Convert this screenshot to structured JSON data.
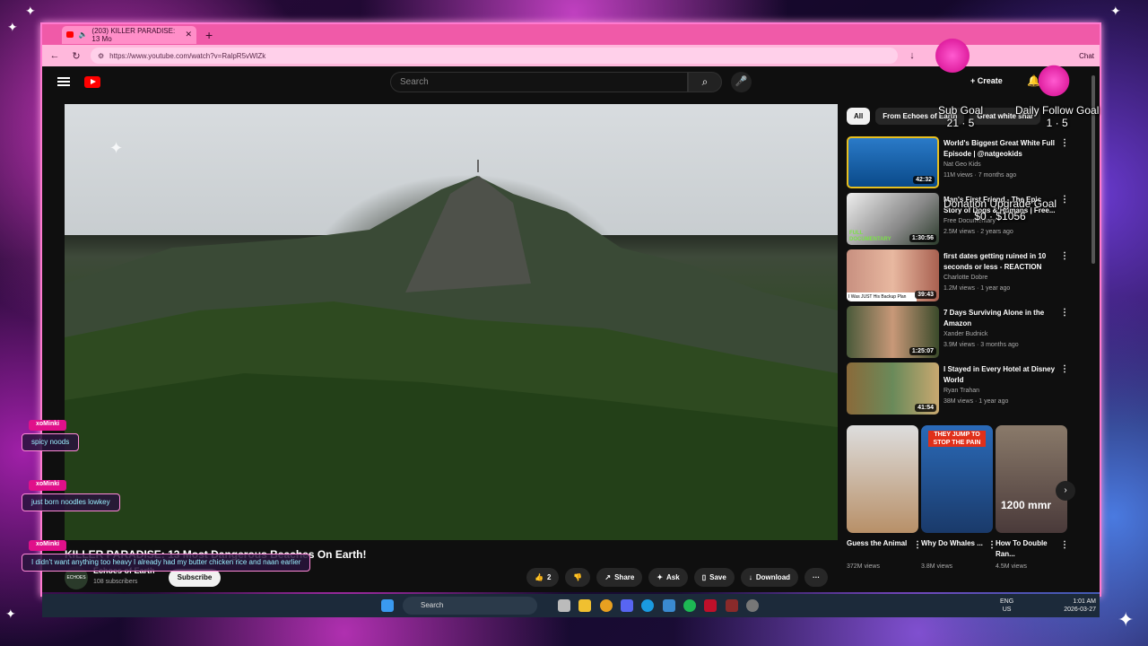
{
  "browser": {
    "tab_title": "(203) KILLER PARADISE: 13 Mo",
    "url": "https://www.youtube.com/watch?v=RalpR5vWlZk",
    "chat_label": "Chat"
  },
  "youtube": {
    "search_placeholder": "Search",
    "create_label": "Create",
    "video_title": "KILLER PARADISE: 13 Most Dangerous Beaches On Earth!",
    "channel": "Echoes of Earth",
    "subscribers": "108 subscribers",
    "subscribe_label": "Subscribe",
    "avatar_text": "ECHOES EARTH",
    "actions": {
      "likes": "2",
      "share": "Share",
      "ask": "Ask",
      "save": "Save",
      "download": "Download"
    },
    "chips": [
      "All",
      "From Echoes of Earth",
      "Great white shar"
    ],
    "recommendations": [
      {
        "title": "World's Biggest Great White Full Episode | @natgeokids",
        "channel": "Nat Geo Kids",
        "meta": "11M views · 7 months ago",
        "duration": "42:32"
      },
      {
        "title": "Man's First Friend - The Epic Story of Dogs & Humans | Free...",
        "channel": "Free Documentary",
        "meta": "2.5M views · 2 years ago",
        "duration": "1:30:56"
      },
      {
        "title": "first dates getting ruined in 10 seconds or less - REACTION",
        "channel": "Charlotte Dobre",
        "meta": "1.2M views · 1 year ago",
        "duration": "39:43"
      },
      {
        "title": "7 Days Surviving Alone in the Amazon",
        "channel": "Xander Budnick",
        "meta": "3.9M views · 3 months ago",
        "duration": "1:25:07"
      },
      {
        "title": "I Stayed in Every Hotel at Disney World",
        "channel": "Ryan Trahan",
        "meta": "38M views · 1 year ago",
        "duration": "41:54"
      }
    ],
    "thumb_text": {
      "full_documentary": "FULL DOCUMENTARY",
      "backup_plan": "I Was JUST His Backup Plan"
    },
    "shorts": [
      {
        "title": "Guess the Animal",
        "views": "372M views"
      },
      {
        "title": "Why Do Whales ...",
        "views": "3.8M views",
        "overlay": "THEY JUMP TO STOP THE PAIN"
      },
      {
        "title": "How To Double Ran...",
        "views": "4.5M views",
        "overlay": "1200 mmr"
      }
    ]
  },
  "overlay": {
    "sub_goal": {
      "label": "Sub Goal",
      "value": "21 · 5"
    },
    "follow_goal": {
      "label": "Daily Follow Goal",
      "value": "1 · 5"
    },
    "donation_goal": {
      "label": "Donation Upgrade Goal",
      "value": "$0 · $1056"
    },
    "chat": [
      {
        "user": "xoMinki",
        "message": "spicy noods"
      },
      {
        "user": "xoMinki",
        "message": "just born noodles lowkey"
      },
      {
        "user": "xoMinki",
        "message": "I didn't want anything too heavy I already had my butter chicken rice and naan earlier"
      }
    ]
  },
  "taskbar": {
    "search_label": "Search",
    "lang": "ENG",
    "region": "US",
    "time": "1:01 AM",
    "date": "2026-03-27"
  },
  "colors": {
    "accent_pink": "#f05aa8",
    "youtube_bg": "#0f0f0f",
    "youtube_red": "#ff0000"
  }
}
